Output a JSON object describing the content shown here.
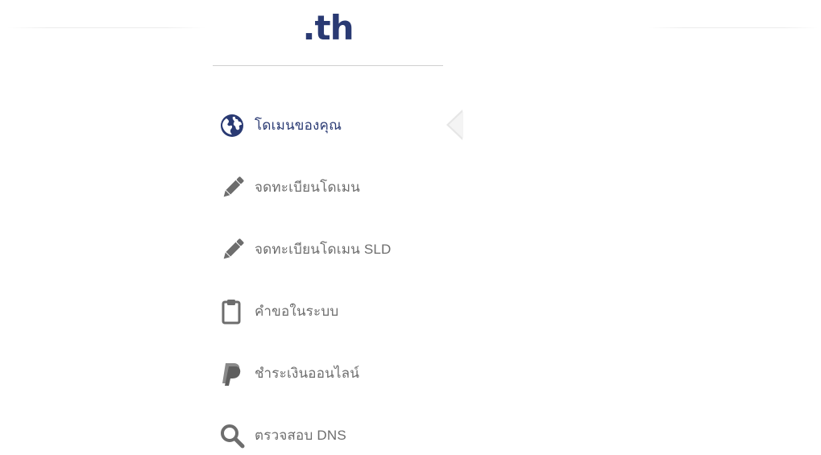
{
  "brand": {
    "logo_text": ".th",
    "logo_color": "#2a3a73"
  },
  "menu": {
    "active_index": 0,
    "active_color": "#2a3a73",
    "inactive_color": "#6d6d6d",
    "items": [
      {
        "label": "โดเมนของคุณ",
        "icon": "globe-icon"
      },
      {
        "label": "จดทะเบียนโดเมน",
        "icon": "pencil-icon"
      },
      {
        "label": "จดทะเบียนโดเมน SLD",
        "icon": "pencil-icon"
      },
      {
        "label": "คำขอในระบบ",
        "icon": "clipboard-icon"
      },
      {
        "label": "ชำระเงินออนไลน์",
        "icon": "paypal-icon"
      },
      {
        "label": "ตรวจสอบ DNS",
        "icon": "search-icon"
      }
    ]
  }
}
